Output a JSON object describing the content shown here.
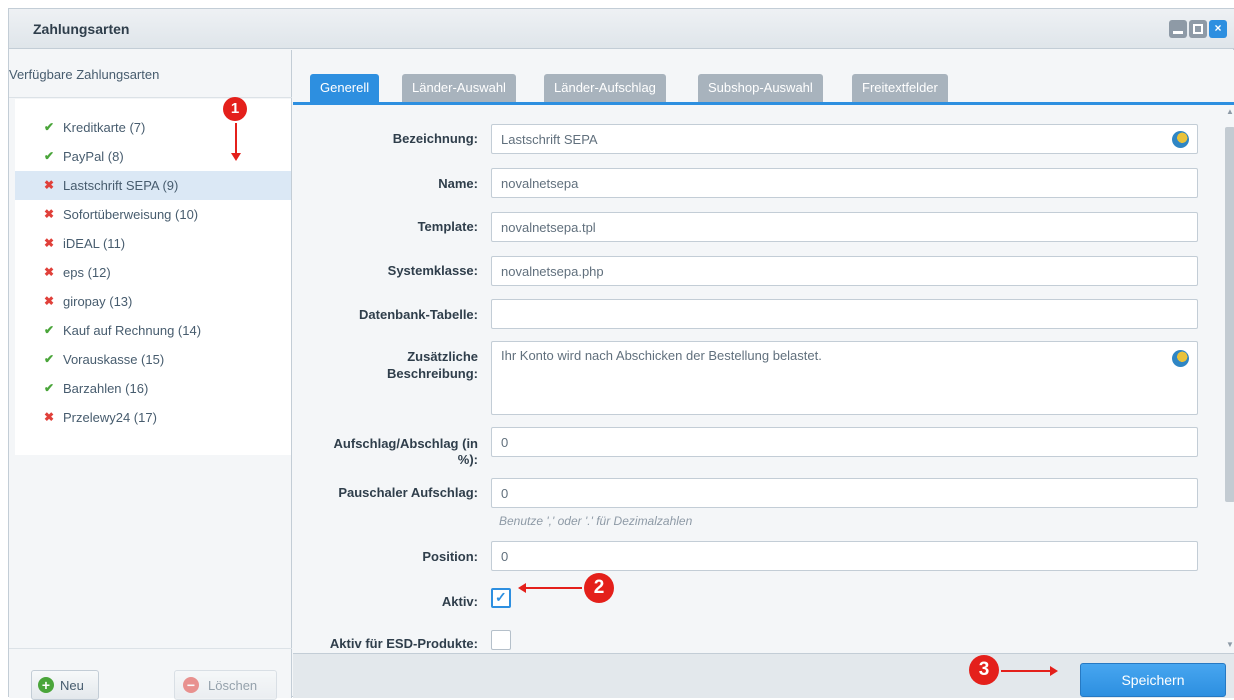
{
  "window": {
    "title": "Zahlungsarten",
    "controls": [
      "minimize-icon",
      "maximize-icon",
      "close-icon"
    ]
  },
  "left_panel": {
    "header": "Verfügbare Zahlungsarten",
    "items": [
      {
        "label": "Kreditkarte (7)",
        "status": "active"
      },
      {
        "label": "PayPal (8)",
        "status": "active"
      },
      {
        "label": "Lastschrift SEPA (9)",
        "status": "inactive",
        "selected": true
      },
      {
        "label": "Sofortüberweisung (10)",
        "status": "inactive"
      },
      {
        "label": "iDEAL (11)",
        "status": "inactive"
      },
      {
        "label": "eps (12)",
        "status": "inactive"
      },
      {
        "label": "giropay (13)",
        "status": "inactive"
      },
      {
        "label": "Kauf auf Rechnung (14)",
        "status": "active"
      },
      {
        "label": "Vorauskasse (15)",
        "status": "active"
      },
      {
        "label": "Barzahlen (16)",
        "status": "active"
      },
      {
        "label": "Przelewy24 (17)",
        "status": "inactive"
      }
    ],
    "new_label": "Neu",
    "delete_label": "Löschen"
  },
  "tabs": [
    "Generell",
    "Länder-Auswahl",
    "Länder-Aufschlag",
    "Subshop-Auswahl",
    "Freitextfelder"
  ],
  "form": {
    "bezeichnung": {
      "label": "Bezeichnung:",
      "value": "Lastschrift SEPA"
    },
    "name": {
      "label": "Name:",
      "value": "novalnetsepa"
    },
    "template": {
      "label": "Template:",
      "value": "novalnetsepa.tpl"
    },
    "systemklasse": {
      "label": "Systemklasse:",
      "value": "novalnetsepa.php"
    },
    "datenbank": {
      "label": "Datenbank-Tabelle:",
      "value": ""
    },
    "beschreibung": {
      "label_1": "Zusätzliche",
      "label_2": "Beschreibung:",
      "value": "Ihr Konto wird nach Abschicken der Bestellung belastet."
    },
    "aufschlag": {
      "label_1": "Aufschlag/Abschlag (in",
      "label_2": "%):",
      "value": "0"
    },
    "pauschal": {
      "label": "Pauschaler Aufschlag:",
      "value": "0",
      "hint": "Benutze ',' oder '.' für Dezimalzahlen"
    },
    "position": {
      "label": "Position:",
      "value": "0"
    },
    "aktiv": {
      "label": "Aktiv:",
      "checked": true
    },
    "aktiv_esd": {
      "label": "Aktiv für ESD-Produkte:",
      "checked": false
    }
  },
  "save_label": "Speichern",
  "annotations": {
    "step1": "1",
    "step2": "2",
    "step3": "3"
  },
  "colors": {
    "accent": "#2d8fe0",
    "annotation": "#e4201b",
    "ok": "#4aa53a",
    "inactive": "#e0403a"
  }
}
